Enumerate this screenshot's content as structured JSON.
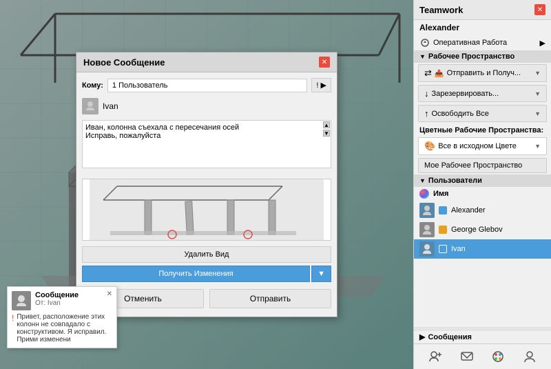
{
  "viewport": {
    "background": "#9ecfc8"
  },
  "teamwork_panel": {
    "title": "Teamwork",
    "user": "Alexander",
    "sections": {
      "operative": "Оперативная Работа",
      "workspace": "Рабочее Пространство",
      "send_receive": "Отправить и Получ...",
      "reserve": "Зарезервировать...",
      "release_all": "Освободить Все",
      "color_ws_label": "Цветные Рабочие Пространства:",
      "all_original_color": "Все в исходном Цвете",
      "my_workspace": "Мое Рабочее Пространство",
      "users": "Пользователи",
      "name_header": "Имя",
      "messages": "Сообщения"
    },
    "users": [
      {
        "name": "Alexander",
        "color": "#4a9cda",
        "has_avatar": true
      },
      {
        "name": "George Glebov",
        "color": "#e8a020",
        "has_avatar": false
      },
      {
        "name": "Ivan",
        "color": "#4a9cda",
        "active": true,
        "has_avatar": true
      }
    ],
    "footer_icons": [
      "add-user",
      "send-message",
      "color-wheel",
      "person"
    ]
  },
  "modal": {
    "title": "Новое Сообщение",
    "to_label": "Кому:",
    "to_value": "1 Пользователь",
    "user_name": "Ivan",
    "message_text": "Иван, колонна съехала с пересечания осей\nИсправь, пожалуйста",
    "delete_view_btn": "Удалить Вид",
    "get_changes_btn": "Получить Изменения",
    "cancel_btn": "Отменить",
    "send_btn": "Отправить"
  },
  "notification": {
    "title": "Сообщение",
    "from_label": "От:",
    "from_user": "Ivan",
    "message": "Привет, расположение этих колонн не совпадало с конструктивом. Я исправил. Прими изменени"
  }
}
